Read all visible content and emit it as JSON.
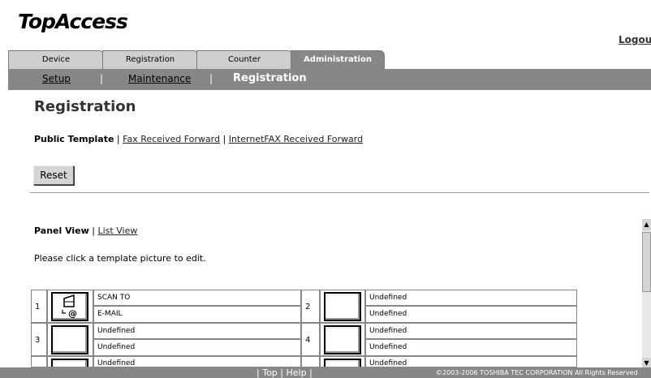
{
  "header": {
    "logo": "TopAccess",
    "logout": "Logout"
  },
  "tabs": [
    {
      "label": "Device",
      "active": false
    },
    {
      "label": "Registration",
      "active": false
    },
    {
      "label": "Counter",
      "active": false
    },
    {
      "label": "Administration",
      "active": true
    }
  ],
  "subnav": {
    "setup": "Setup",
    "maintenance": "Maintenance",
    "registration": "Registration",
    "sep": "|"
  },
  "page": {
    "title": "Registration"
  },
  "template_tabs": {
    "public": "Public Template",
    "fax": "Fax Received Forward",
    "internetfax": "InternetFAX Received Forward",
    "sep": "|"
  },
  "reset_label": "Reset",
  "view_tabs": {
    "panel": "Panel View",
    "list": "List View",
    "sep": "|"
  },
  "instruction": "Please click a template picture to edit.",
  "templates": [
    {
      "num": "1",
      "line1": "SCAN TO",
      "line2": "E-MAIL",
      "icon": "scan-to-email-icon"
    },
    {
      "num": "2",
      "line1": "Undefined",
      "line2": "Undefined",
      "icon": "blank-template-icon"
    },
    {
      "num": "3",
      "line1": "Undefined",
      "line2": "Undefined",
      "icon": "blank-template-icon"
    },
    {
      "num": "4",
      "line1": "Undefined",
      "line2": "Undefined",
      "icon": "blank-template-icon"
    },
    {
      "num": "",
      "line1": "Undefined",
      "line2": "",
      "icon": "blank-template-icon"
    },
    {
      "num": "",
      "line1": "Undefined",
      "line2": "",
      "icon": "blank-template-icon"
    }
  ],
  "footer": {
    "top": "Top",
    "help": "Help",
    "sep": "|",
    "copyright": "©2003-2006 TOSHIBA TEC CORPORATION All Rights Reserved"
  }
}
